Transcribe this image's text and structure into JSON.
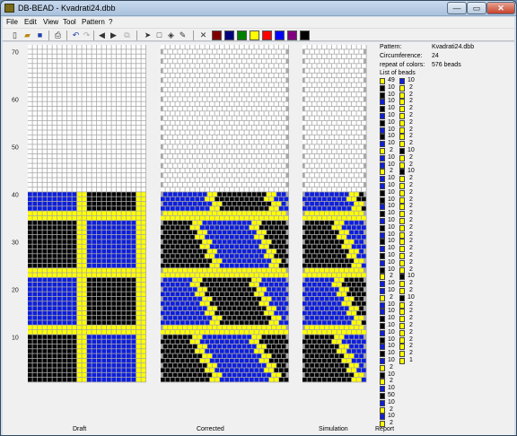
{
  "window": {
    "title": "DB-BEAD - Kvadrati24.dbb",
    "min": "—",
    "max": "▭",
    "close": "✕"
  },
  "menu": [
    "File",
    "Edit",
    "View",
    "Tool",
    "Pattern",
    "?"
  ],
  "palette": {
    "colors": [
      "#ffffff",
      "#800000",
      "#000080",
      "#008000",
      "#ffff00",
      "#ff0000",
      "#0000ff",
      "#800080",
      "#000000"
    ],
    "selected_color": "#ffff00"
  },
  "colors": {
    "yellow": "#ffff00",
    "blue": "#0d1edc",
    "black": "#050505",
    "empty": "#ffffff",
    "grid_line": "#a8a8a8"
  },
  "axis": {
    "ticks": [
      "10",
      "20",
      "30",
      "40",
      "50",
      "60",
      "70"
    ]
  },
  "views": {
    "draft_label": "Draft",
    "corrected_label": "Corrected",
    "simulation_label": "Simulation",
    "report_label": "Report"
  },
  "info": {
    "pattern_label": "Pattern:",
    "pattern_value": "Kvadrati24.dbb",
    "circumference_label": "Circumference:",
    "circumference_value": "24",
    "repeat_label": "repeat of colors:",
    "repeat_value": "576 beads",
    "list_label": "List of beads"
  },
  "bead_list": [
    [
      "Y",
      "49",
      "B",
      "10"
    ],
    [
      "K",
      "10",
      "Y",
      "2"
    ],
    [
      "K",
      "10",
      "Y",
      "2"
    ],
    [
      "B",
      "10",
      "Y",
      "2"
    ],
    [
      "K",
      "10",
      "Y",
      "2"
    ],
    [
      "B",
      "10",
      "Y",
      "2"
    ],
    [
      "K",
      "10",
      "Y",
      "2"
    ],
    [
      "B",
      "10",
      "Y",
      "2"
    ],
    [
      "K",
      "10",
      "Y",
      "2"
    ],
    [
      "B",
      "10",
      "Y",
      "2"
    ],
    [
      "Y",
      "2",
      "K",
      "10"
    ],
    [
      "B",
      "10",
      "Y",
      "2"
    ],
    [
      "B",
      "10",
      "Y",
      "2"
    ],
    [
      "Y",
      "2",
      "K",
      "10"
    ],
    [
      "B",
      "10",
      "Y",
      "2"
    ],
    [
      "B",
      "10",
      "Y",
      "2"
    ],
    [
      "K",
      "10",
      "Y",
      "2"
    ],
    [
      "K",
      "10",
      "Y",
      "2"
    ],
    [
      "B",
      "10",
      "Y",
      "2"
    ],
    [
      "K",
      "10",
      "Y",
      "2"
    ],
    [
      "B",
      "10",
      "Y",
      "2"
    ],
    [
      "K",
      "10",
      "Y",
      "2"
    ],
    [
      "B",
      "10",
      "Y",
      "2"
    ],
    [
      "K",
      "10",
      "Y",
      "2"
    ],
    [
      "B",
      "10",
      "Y",
      "2"
    ],
    [
      "K",
      "10",
      "Y",
      "2"
    ],
    [
      "B",
      "10",
      "Y",
      "2"
    ],
    [
      "K",
      "10",
      "Y",
      "2"
    ],
    [
      "Y",
      "2",
      "K",
      "10"
    ],
    [
      "B",
      "10",
      "Y",
      "2"
    ],
    [
      "B",
      "10",
      "Y",
      "2"
    ],
    [
      "Y",
      "2",
      "K",
      "10"
    ],
    [
      "B",
      "10",
      "Y",
      "2"
    ],
    [
      "B",
      "10",
      "Y",
      "2"
    ],
    [
      "K",
      "10",
      "Y",
      "2"
    ],
    [
      "K",
      "10",
      "Y",
      "2"
    ],
    [
      "B",
      "10",
      "Y",
      "2"
    ],
    [
      "K",
      "10",
      "Y",
      "2"
    ],
    [
      "B",
      "10",
      "Y",
      "2"
    ],
    [
      "K",
      "10",
      "Y",
      "2"
    ],
    [
      "B",
      "10",
      "Y",
      "1"
    ],
    [
      "Y",
      "2",
      null,
      null
    ],
    [
      "K",
      "10",
      null,
      null
    ],
    [
      "Y",
      "2",
      null,
      null
    ],
    [
      "B",
      "10",
      null,
      null
    ],
    [
      "K",
      "50",
      null,
      null
    ],
    [
      "B",
      "10",
      null,
      null
    ],
    [
      "Y",
      "2",
      null,
      null
    ],
    [
      "B",
      "10",
      null,
      null
    ],
    [
      "Y",
      "2",
      null,
      null
    ]
  ]
}
